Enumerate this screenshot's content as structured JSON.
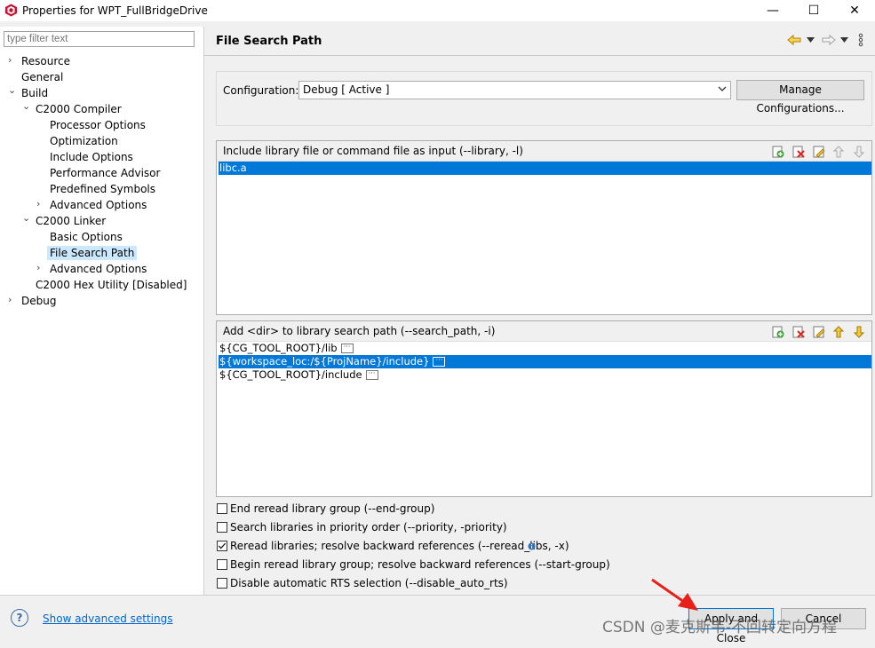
{
  "window": {
    "title": "Properties for WPT_FullBridgeDrive",
    "minimize_glyph": "—",
    "maximize_glyph": "☐",
    "close_glyph": "✕"
  },
  "sidebar": {
    "filter_placeholder": "type filter text",
    "items": [
      {
        "label": "Resource",
        "twisty": "›"
      },
      {
        "label": "General",
        "twisty": ""
      },
      {
        "label": "Build",
        "twisty": "⌄"
      },
      {
        "label": "C2000 Compiler",
        "twisty": "⌄"
      },
      {
        "label": "Processor Options",
        "twisty": ""
      },
      {
        "label": "Optimization",
        "twisty": ""
      },
      {
        "label": "Include Options",
        "twisty": ""
      },
      {
        "label": "Performance Advisor",
        "twisty": ""
      },
      {
        "label": "Predefined Symbols",
        "twisty": ""
      },
      {
        "label": "Advanced Options",
        "twisty": "›"
      },
      {
        "label": "C2000 Linker",
        "twisty": "⌄"
      },
      {
        "label": "Basic Options",
        "twisty": ""
      },
      {
        "label": "File Search Path",
        "twisty": "",
        "selected": true
      },
      {
        "label": "Advanced Options",
        "twisty": "›"
      },
      {
        "label": "C2000 Hex Utility  [Disabled]",
        "twisty": ""
      },
      {
        "label": "Debug",
        "twisty": "›"
      }
    ]
  },
  "page": {
    "title": "File Search Path",
    "nav_icons": [
      "back-arrow-icon",
      "dropdown-icon",
      "forward-arrow-icon",
      "dropdown-icon",
      "view-menu-icon"
    ]
  },
  "configuration": {
    "label": "Configuration:",
    "value": "Debug  [ Active ]",
    "manage_button": "Manage Configurations..."
  },
  "library_panel": {
    "header": "Include library file or command file as input (--library, -l)",
    "items": [
      {
        "text": "libc.a",
        "selected": true
      }
    ]
  },
  "search_path_panel": {
    "header": "Add <dir> to library search path (--search_path, -i)",
    "items": [
      {
        "text": "${CG_TOOL_ROOT}/lib",
        "selected": false
      },
      {
        "text": "${workspace_loc:/${ProjName}/include}",
        "selected": true
      },
      {
        "text": "${CG_TOOL_ROOT}/include",
        "selected": false
      }
    ],
    "ellipsis": "···"
  },
  "toolbar_icons": [
    "add-icon",
    "delete-icon",
    "edit-icon",
    "move-up-icon",
    "move-down-icon"
  ],
  "options": [
    {
      "label": "End reread library group (--end-group)",
      "checked": false
    },
    {
      "label": "Search libraries in priority order (--priority, -priority)",
      "checked": false
    },
    {
      "label": "Reread libraries; resolve backward references (--reread_libs, -x)",
      "checked": true
    },
    {
      "label": "Begin reread library group; resolve backward references (--start-group)",
      "checked": false
    },
    {
      "label": "Disable automatic RTS selection (--disable_auto_rts)",
      "checked": false
    }
  ],
  "footer": {
    "help_glyph": "?",
    "advanced_link": "Show advanced settings",
    "apply_close": "Apply and Close",
    "cancel": "Cancel"
  },
  "watermark": "CSDN @麦克斯韦-不回转定向方程",
  "colors": {
    "selection": "#0078d7",
    "tree_selection": "#cce8ff",
    "link": "#0066cc",
    "arrow": "#e8201a"
  }
}
